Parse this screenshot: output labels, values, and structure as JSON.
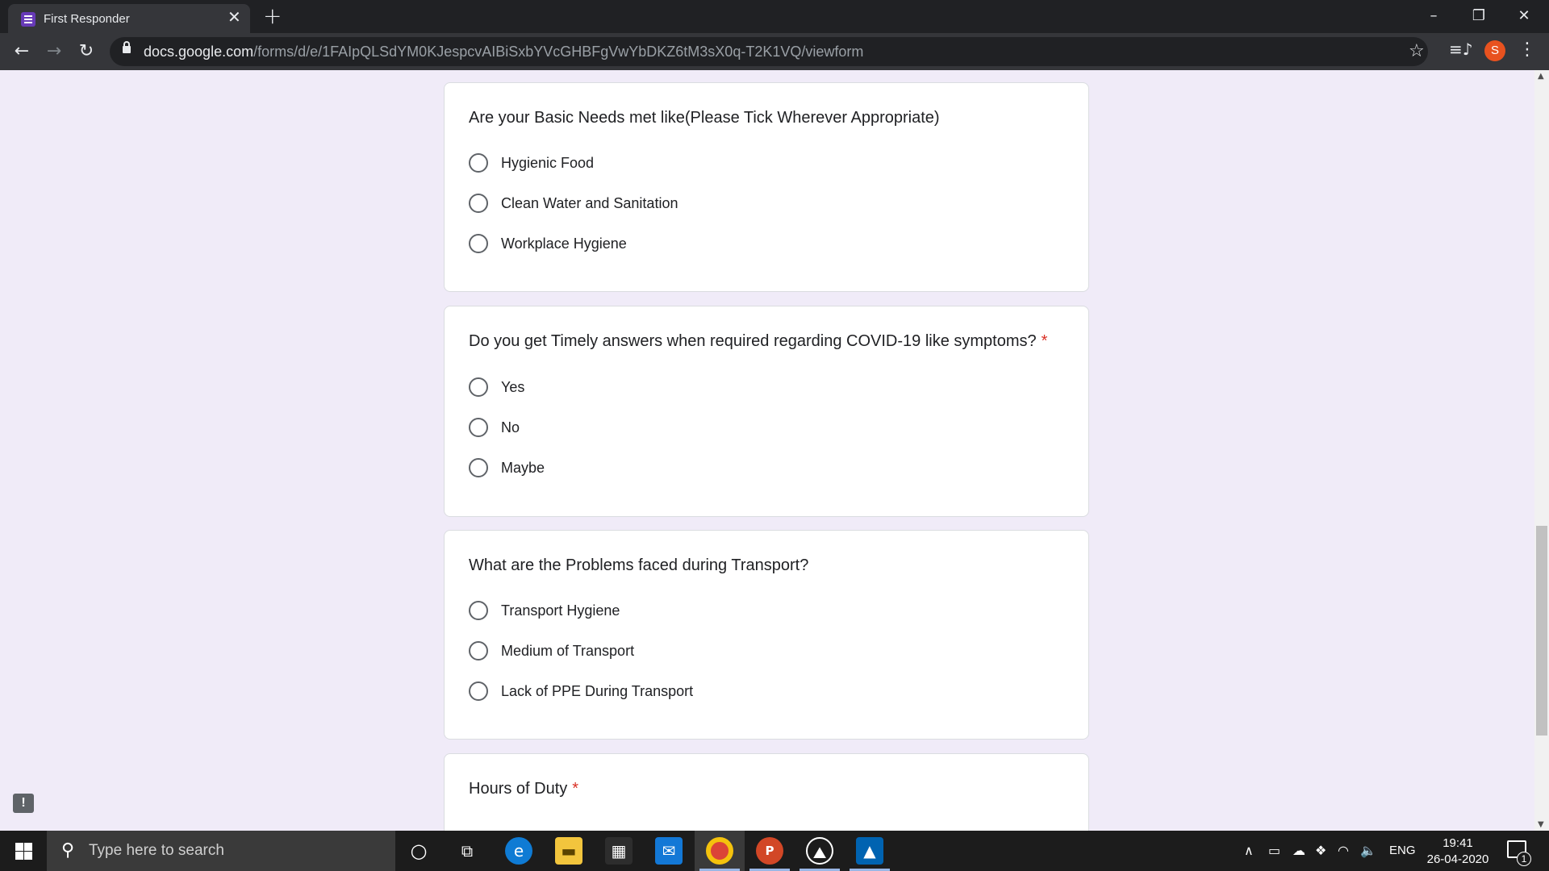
{
  "browser": {
    "tab_title": "First Responder",
    "url_host": "docs.google.com",
    "url_path": "/forms/d/e/1FAIpQLSdYM0KJespcvAIBiSxbYVcGHBFgVwYbDKZ6tM3sX0q-T2K1VQ/viewform",
    "profile_initial": "S"
  },
  "form": {
    "questions": [
      {
        "text": "Are your Basic Needs met like(Please Tick Wherever Appropriate)",
        "required": false,
        "options": [
          "Hygienic Food",
          "Clean Water and Sanitation",
          "Workplace Hygiene"
        ]
      },
      {
        "text": "Do you get Timely answers when required regarding COVID-19 like symptoms?",
        "required": true,
        "required_mark": "*",
        "options": [
          "Yes",
          "No",
          "Maybe"
        ]
      },
      {
        "text": "What are the Problems faced during Transport?",
        "required": false,
        "options": [
          "Transport Hygiene",
          "Medium of Transport",
          "Lack of PPE During Transport"
        ]
      },
      {
        "text": "Hours of Duty",
        "required": true,
        "required_mark": "*",
        "options": []
      }
    ]
  },
  "taskbar": {
    "search_placeholder": "Type here to search",
    "language": "ENG",
    "time": "19:41",
    "date": "26-04-2020",
    "notification_count": "1"
  },
  "colors": {
    "form_background": "#f0ebf8",
    "required_mark": "#d93025",
    "forms_brand": "#673ab7"
  }
}
